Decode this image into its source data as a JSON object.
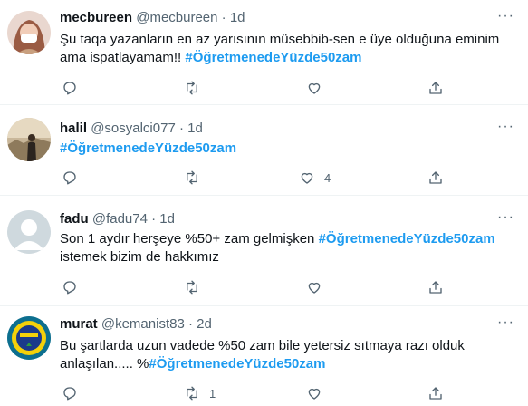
{
  "tweets": [
    {
      "name": "mecbureen",
      "handle": "@mecbureen",
      "time": "1d",
      "text_before": "Şu taqa yazanların en az yarısının müsebbib-sen e üye olduğuna eminim ama ispatlayamam!! ",
      "hashtag": "#ÖğretmenedeYüzde50zam",
      "text_after": "",
      "reply_count": "",
      "retweet_count": "",
      "like_count": ""
    },
    {
      "name": "halil",
      "handle": "@sosyalci077",
      "time": "1d",
      "text_before": "",
      "hashtag": "#ÖğretmenedeYüzde50zam",
      "text_after": "",
      "reply_count": "",
      "retweet_count": "",
      "like_count": "4"
    },
    {
      "name": "fadu",
      "handle": "@fadu74",
      "time": "1d",
      "text_before": "Son 1 aydır herşeye %50+ zam gelmişken ",
      "hashtag": "#ÖğretmenedeYüzde50zam",
      "text_after": " istemek bizim de hakkımız",
      "reply_count": "",
      "retweet_count": "",
      "like_count": ""
    },
    {
      "name": "murat",
      "handle": "@kemanist83",
      "time": "2d",
      "text_before": "Bu şartlarda uzun vadede %50 zam bile yetersiz sıtmaya razı olduk anlaşılan..... %",
      "hashtag": "#ÖğretmenedeYüzde50zam",
      "text_after": "",
      "reply_count": "",
      "retweet_count": "1",
      "like_count": ""
    }
  ],
  "colors": {
    "hashtag": "#1d9bf0",
    "secondary": "#536471",
    "divider": "#eff3f4"
  },
  "icons": {
    "reply": "reply-icon",
    "retweet": "retweet-icon",
    "like": "heart-icon",
    "share": "share-icon",
    "more": "more-icon"
  }
}
